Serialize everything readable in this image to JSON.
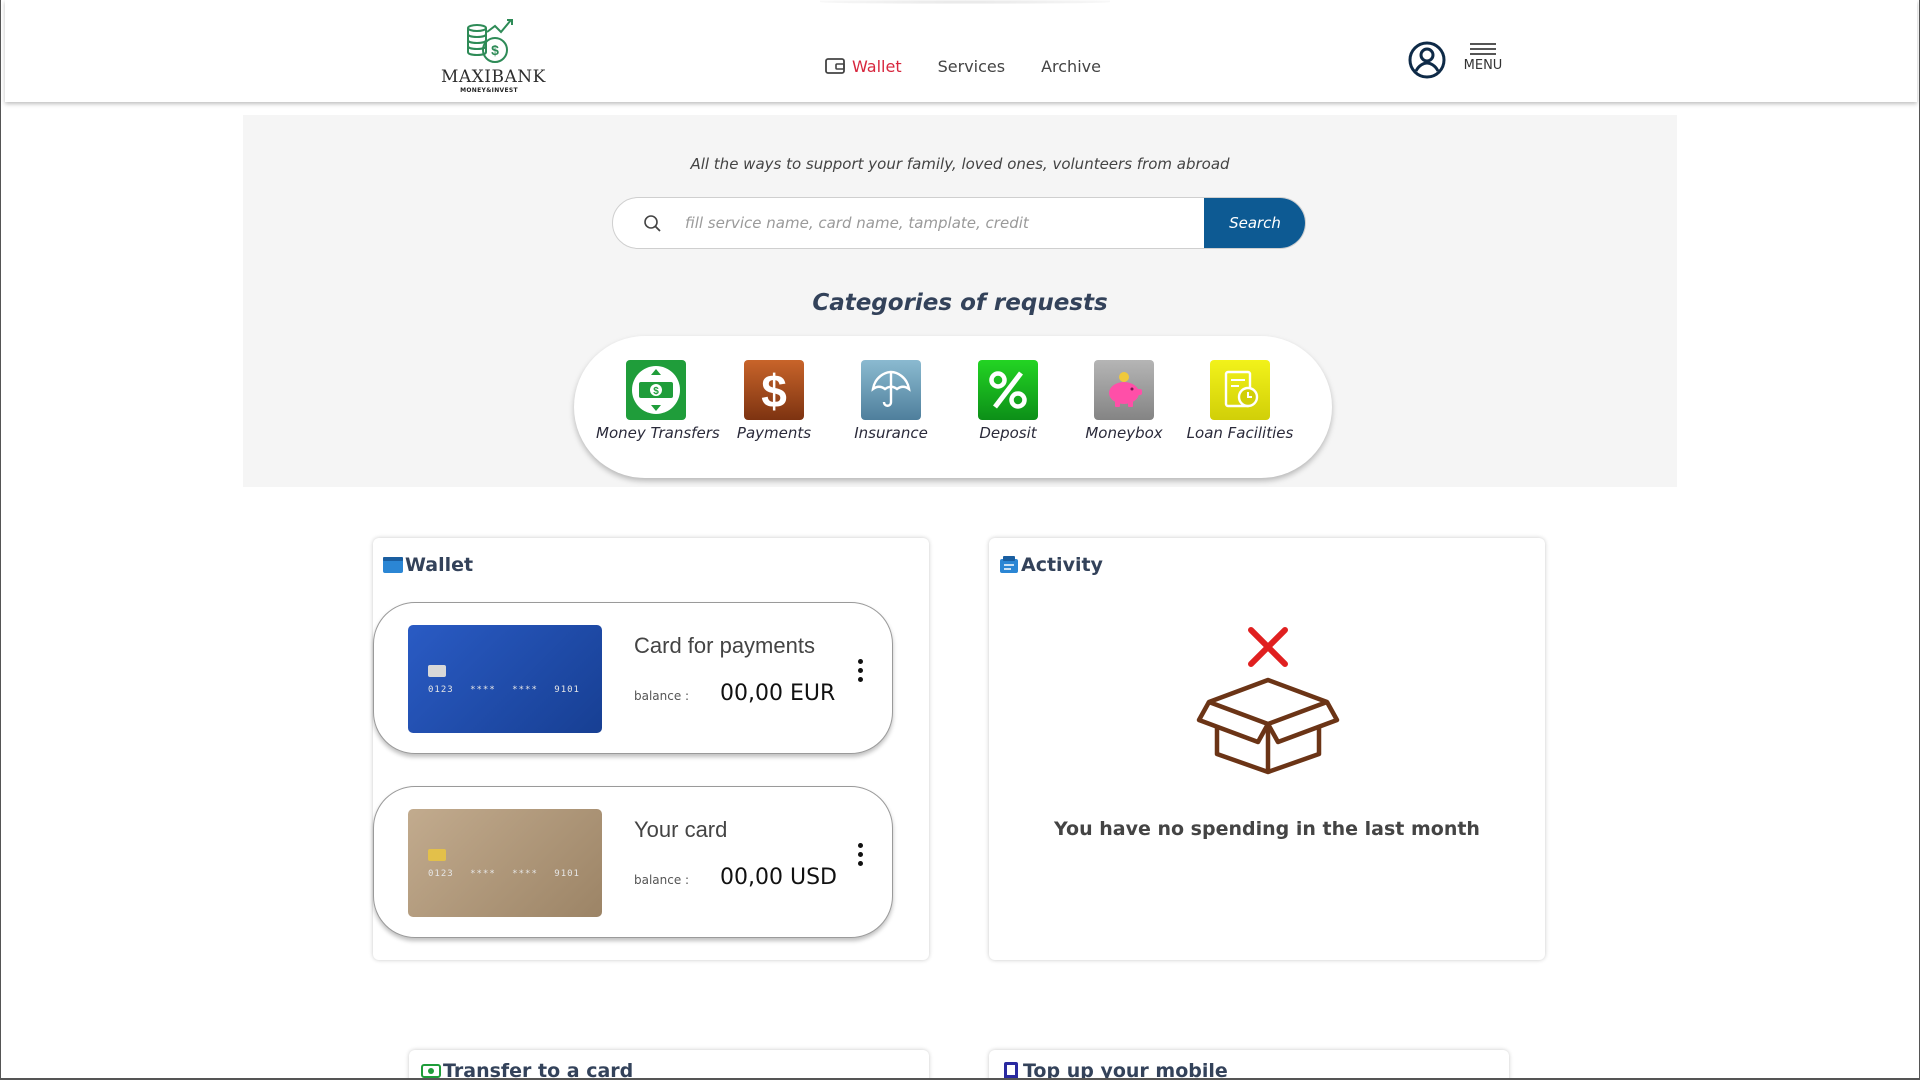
{
  "brand": {
    "name": "MAXIBANK",
    "tagline": "MONEY&INVEST"
  },
  "nav": {
    "items": [
      {
        "label": "Wallet",
        "active": true,
        "icon": "wallet-icon"
      },
      {
        "label": "Services",
        "active": false
      },
      {
        "label": "Archive",
        "active": false
      }
    ]
  },
  "header": {
    "menu_label": "MENU",
    "user_icon": "user-circle-icon"
  },
  "hero": {
    "tagline": "All the ways to support your family, loved ones, volunteers from abroad",
    "search": {
      "placeholder": "fill service name, card name, tamplate, credit",
      "button_label": "Search"
    },
    "categories_title": "Categories of requests",
    "categories": [
      {
        "label": "Money Transfers",
        "icon": "money-transfer-icon",
        "color": "#1f9d3a"
      },
      {
        "label": "Payments",
        "icon": "dollar-icon",
        "color": "#b8541c"
      },
      {
        "label": "Insurance",
        "icon": "umbrella-icon",
        "color": "#6fa6c0"
      },
      {
        "label": "Deposit",
        "icon": "percent-icon",
        "color": "#1fc21f"
      },
      {
        "label": "Moneybox",
        "icon": "piggy-bank-icon",
        "color": "#9c9c9c"
      },
      {
        "label": "Loan Facilities",
        "icon": "loan-document-icon",
        "color": "#e4e213"
      }
    ]
  },
  "wallet": {
    "title": "Wallet",
    "cards": [
      {
        "name": "Card for payments",
        "balance_label": "balance :",
        "balance": "00,00 EUR",
        "number": "0123 **** **** 9101",
        "color": "#1f4fb0"
      },
      {
        "name": "Your card",
        "balance_label": "balance :",
        "balance": "00,00 USD",
        "number": "0123 **** **** 9101",
        "color": "#b49c7e"
      }
    ]
  },
  "activity": {
    "title": "Activity",
    "empty_message": "You have no spending in the last month"
  },
  "bottom_panels": {
    "transfer_title": "Transfer to a card",
    "topup_title": "Top up your mobile"
  },
  "colors": {
    "accent_red": "#d7263d",
    "primary_blue": "#0d5a93",
    "heading": "#33425a"
  }
}
